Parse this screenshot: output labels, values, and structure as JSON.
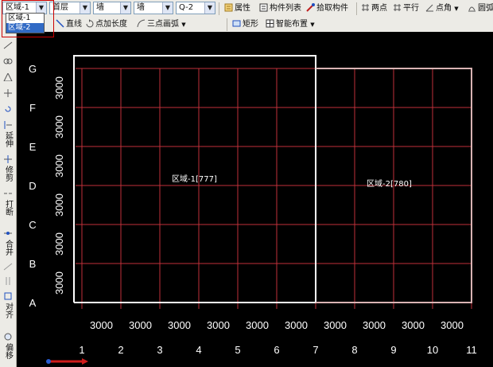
{
  "toolbar1": {
    "region_select": "区域-1",
    "floor_select": "首层",
    "type_select": "墙",
    "subtype_select": "墙",
    "component_select": "Q-2",
    "properties": "属性",
    "component_list": "构件列表",
    "pick_component": "拾取构件",
    "two_points": "两点",
    "parallel": "平行",
    "point_angle": "点角",
    "circle": "圆弧"
  },
  "region_dropdown": {
    "options": [
      "区域-1",
      "区域-2"
    ],
    "selected": "区域-2"
  },
  "toolbar2": {
    "line": "直线",
    "point_add_length": "点加长度",
    "three_point_arc": "三点画弧",
    "rectangle": "矩形",
    "smart_layout": "智能布置"
  },
  "leftbar": {
    "extend": "延伸",
    "trim": "修剪",
    "break": "打断",
    "merge": "合并",
    "align": "对齐",
    "offset": "偏移"
  },
  "grid": {
    "row_labels": [
      "G",
      "F",
      "E",
      "D",
      "C",
      "B",
      "A"
    ],
    "row_spacing_labels": [
      "3000",
      "3000",
      "3000",
      "3000",
      "3000",
      "3000"
    ],
    "col_labels": [
      "1",
      "2",
      "3",
      "4",
      "5",
      "6",
      "7",
      "8",
      "9",
      "10",
      "11"
    ],
    "col_spacing_labels": [
      "3000",
      "3000",
      "3000",
      "3000",
      "3000",
      "3000",
      "3000",
      "3000",
      "3000",
      "3000"
    ]
  },
  "regions": {
    "region1": "区域-1[777]",
    "region2": "区域-2[780]"
  },
  "colors": {
    "grid": "#c0313a",
    "region1_border": "#ffffff",
    "region2_border": "#d9b3b3"
  }
}
